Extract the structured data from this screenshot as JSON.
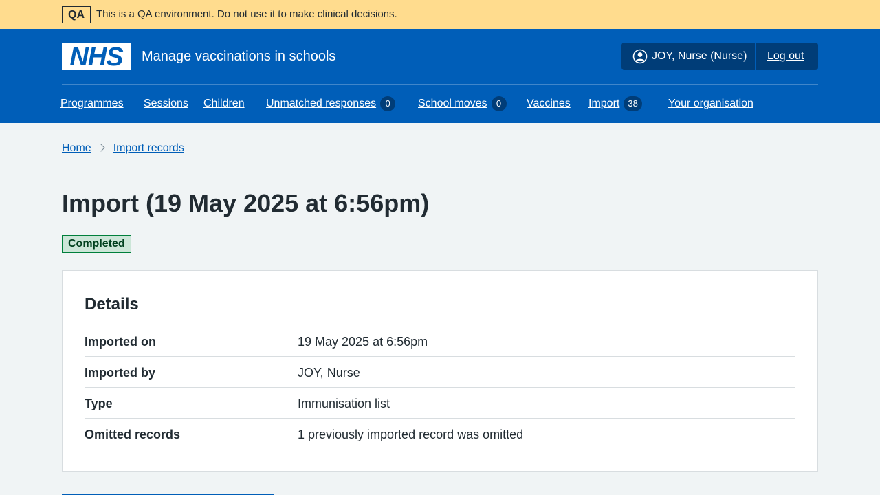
{
  "env_banner": {
    "tag": "QA",
    "text": "This is a QA environment. Do not use it to make clinical decisions.",
    "color": "#ffdc8e"
  },
  "header": {
    "logo_text": "NHS",
    "service_name": "Manage vaccinations in schools",
    "user_icon": "user-circle-icon",
    "user_name": "JOY, Nurse (Nurse)",
    "logout_label": "Log out",
    "brand_color": "#005eb8"
  },
  "nav": {
    "items": [
      {
        "label": "Programmes"
      },
      {
        "label": "Sessions"
      },
      {
        "label": "Children"
      },
      {
        "label": "Unmatched responses",
        "count": "0"
      },
      {
        "label": "School moves",
        "count": "0"
      },
      {
        "label": "Vaccines"
      },
      {
        "label": "Import",
        "count": "38"
      },
      {
        "label": "Your organisation"
      }
    ]
  },
  "breadcrumb": {
    "items": [
      "Home",
      "Import records"
    ],
    "separator_icon": "chevron-right-icon"
  },
  "page": {
    "title": "Import (19 May 2025 at 6:56pm)",
    "status": "Completed",
    "status_color": "#007f3b"
  },
  "details": {
    "title": "Details",
    "rows": [
      {
        "key": "Imported on",
        "value": "19 May 2025 at 6:56pm"
      },
      {
        "key": "Imported by",
        "value": "JOY, Nurse"
      },
      {
        "key": "Type",
        "value": "Immunisation list"
      },
      {
        "key": "Omitted records",
        "value": "1 previously imported record was omitted"
      }
    ]
  }
}
